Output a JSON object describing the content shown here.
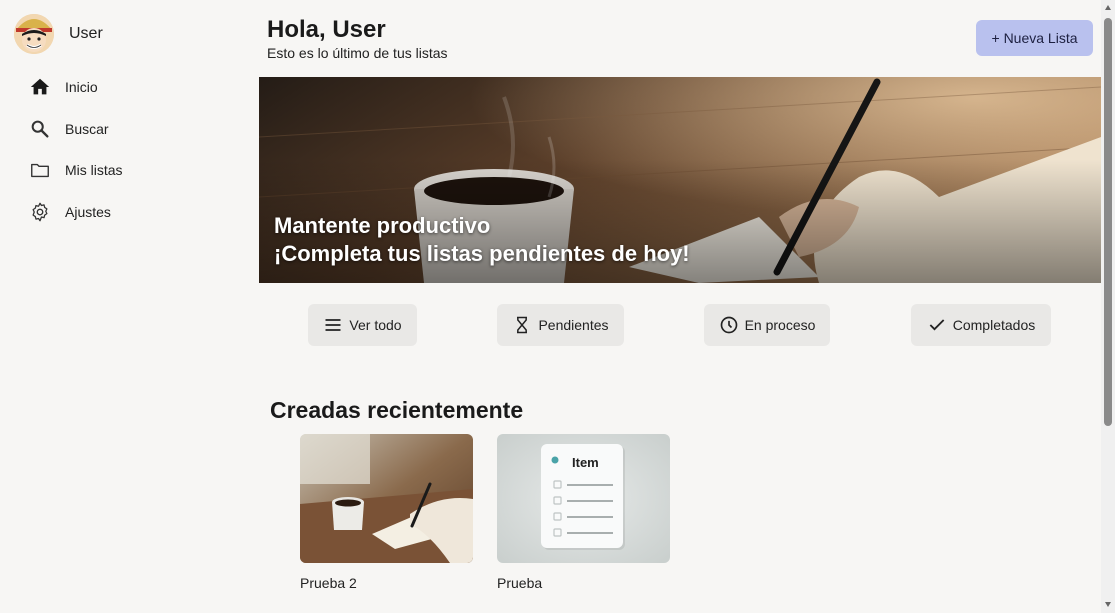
{
  "user": {
    "name": "User"
  },
  "sidebar": {
    "items": [
      {
        "label": "Inicio",
        "icon": "home-icon"
      },
      {
        "label": "Buscar",
        "icon": "search-icon"
      },
      {
        "label": "Mis listas",
        "icon": "folder-icon"
      },
      {
        "label": "Ajustes",
        "icon": "gear-icon"
      }
    ]
  },
  "header": {
    "greeting": "Hola, User",
    "subtitle": "Esto es lo último de tus listas",
    "new_list_label": "+ Nueva Lista"
  },
  "hero": {
    "line1": "Mantente productivo",
    "line2": "¡Completa tus listas pendientes de hoy!"
  },
  "filters": [
    {
      "label": "Ver todo",
      "icon": "menu-icon"
    },
    {
      "label": "Pendientes",
      "icon": "hourglass-icon"
    },
    {
      "label": "En proceso",
      "icon": "clock-icon"
    },
    {
      "label": "Completados",
      "icon": "check-icon"
    }
  ],
  "recent": {
    "title": "Creadas recientemente",
    "cards": [
      {
        "title": "Prueba 2",
        "thumb": "coffee-writing-thumbnail"
      },
      {
        "title": "Prueba",
        "thumb": "item-checklist-thumbnail",
        "thumb_text": "Item"
      }
    ]
  },
  "colors": {
    "accent_button": "#b9c1ee",
    "background": "#f7f6f4",
    "filter_button": "#e9e8e6"
  }
}
